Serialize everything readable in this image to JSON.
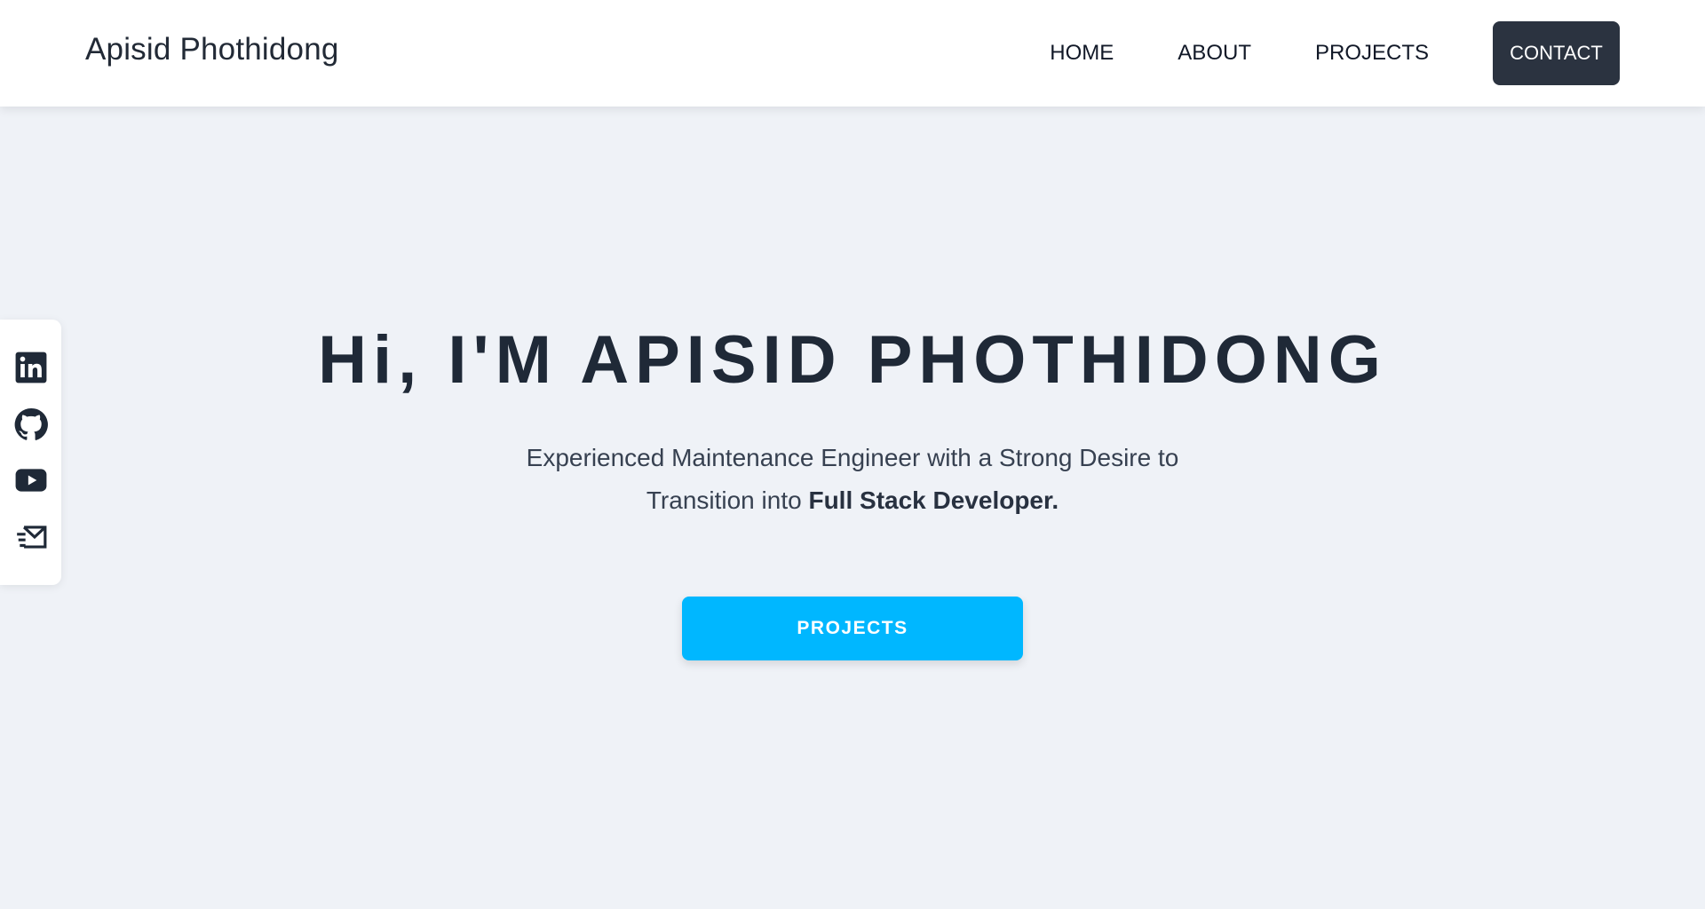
{
  "header": {
    "brand": "Apisid Phothidong",
    "nav": [
      {
        "label": "HOME"
      },
      {
        "label": "ABOUT"
      },
      {
        "label": "PROJECTS"
      }
    ],
    "contact_label": "CONTACT"
  },
  "social": {
    "icons": [
      "linkedin-icon",
      "github-icon",
      "youtube-icon",
      "mail-icon"
    ]
  },
  "hero": {
    "title": "Hi, I'M APISID PHOTHIDONG",
    "subtitle_text": "Experienced Maintenance Engineer with a Strong Desire to Transition into",
    "subtitle_bold": "Full Stack Developer.",
    "cta_label": "PROJECTS"
  },
  "colors": {
    "background": "#eff2f7",
    "header": "#ffffff",
    "contact_button": "#2b3340",
    "cta_button": "#00b7ff",
    "text_dark": "#1f2937"
  }
}
